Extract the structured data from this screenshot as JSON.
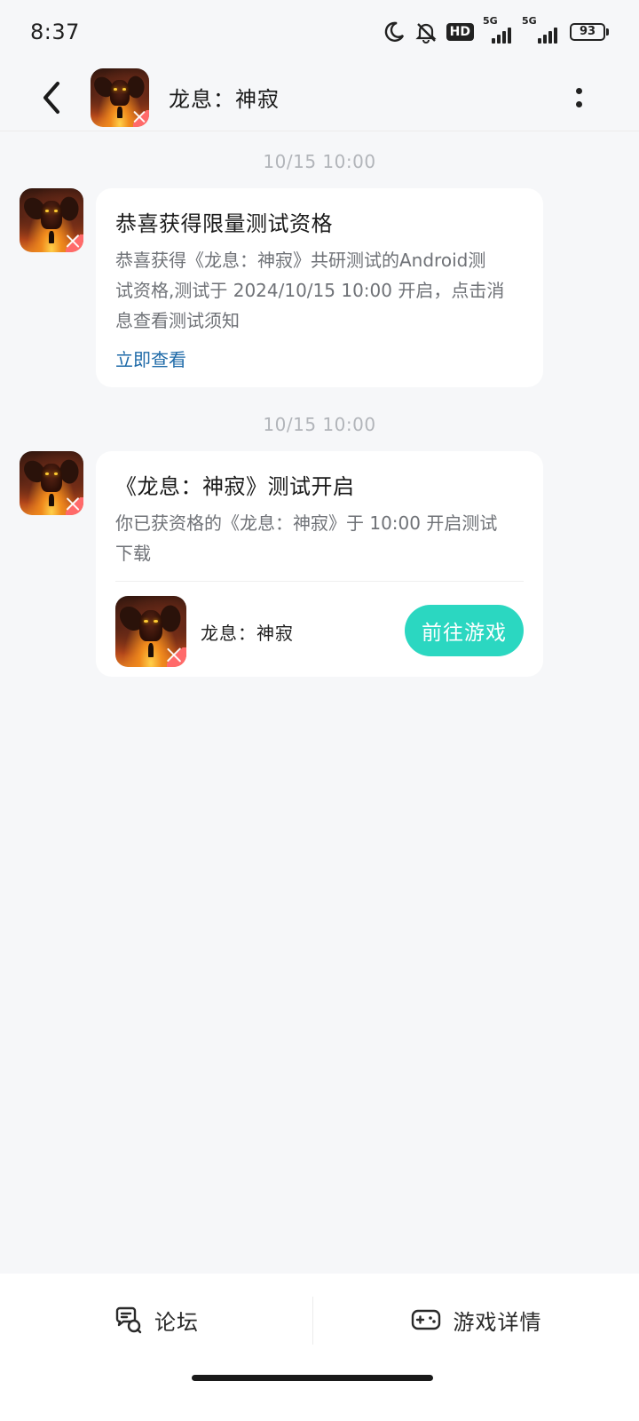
{
  "status_bar": {
    "time": "8:37",
    "hd_label": "HD",
    "signal_1_label": "5G",
    "signal_2_label": "5G",
    "battery_level": "93",
    "icons": [
      "moon-icon",
      "bell-off-icon",
      "hd-icon",
      "signal-icon",
      "signal-icon",
      "battery-icon"
    ]
  },
  "header": {
    "title": "龙息：神寂",
    "back_icon": "chevron-left-icon",
    "more_icon": "more-vertical-icon"
  },
  "messages": [
    {
      "timestamp": "10/15  10:00",
      "title": "恭喜获得限量测试资格",
      "body_line_1": "恭喜获得《龙息：神寂》共研测试的Android测",
      "body_line_2": "试资格,测试于 2024/10/15 10:00 开启，点击消",
      "body_line_3": "息查看测试须知",
      "link": "立即查看"
    },
    {
      "timestamp": "10/15  10:00",
      "title": "《龙息：神寂》测试开启",
      "body_line_1": "你已获资格的《龙息：神寂》于 10:00 开启测试",
      "body_line_2": "下载",
      "game_name": "龙息：神寂",
      "button": "前往游戏"
    }
  ],
  "bottom_bar": {
    "forum_label": "论坛",
    "detail_label": "游戏详情",
    "forum_icon": "chat-bubbles-icon",
    "detail_icon": "gamepad-icon"
  },
  "colors": {
    "accent": "#2bd7c1",
    "link": "#1e6aa8",
    "background": "#f6f7f9"
  }
}
